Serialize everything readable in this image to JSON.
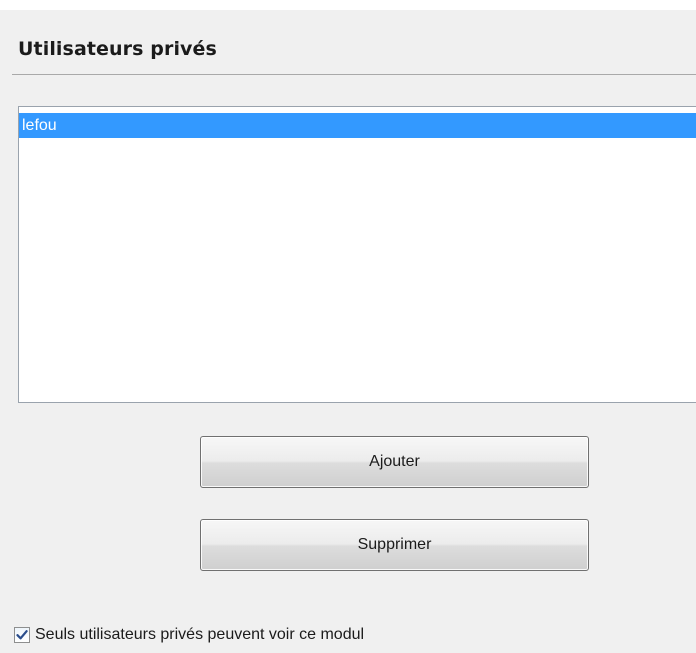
{
  "section": {
    "title": "Utilisateurs privés"
  },
  "users_list": {
    "items": [
      {
        "label": "lefou",
        "selected": true
      }
    ]
  },
  "buttons": {
    "add_label": "Ajouter",
    "remove_label": "Supprimer"
  },
  "private_only": {
    "checked": true,
    "label": "Seuls utilisateurs privés peuvent voir ce modul"
  },
  "colors": {
    "selection": "#3399ff",
    "checkmark": "#2a4d8c"
  }
}
